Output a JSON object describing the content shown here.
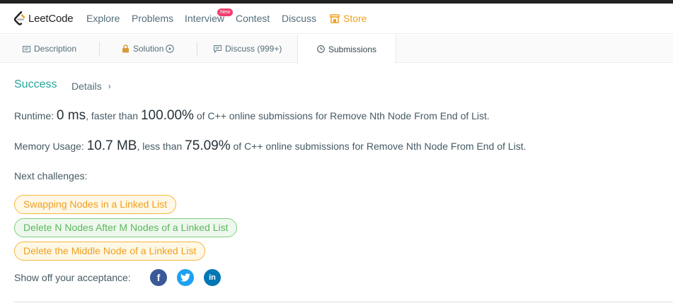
{
  "nav": {
    "logo_text": "LeetCode",
    "items": [
      "Explore",
      "Problems",
      "Interview",
      "Contest",
      "Discuss"
    ],
    "new_badge": "New",
    "store_label": "Store"
  },
  "tabs": {
    "description": "Description",
    "solution": "Solution",
    "discuss": "Discuss (999+)",
    "submissions": "Submissions"
  },
  "result": {
    "status": "Success",
    "details": "Details",
    "runtime_label": "Runtime: ",
    "runtime_value": "0 ms",
    "runtime_mid": ", faster than ",
    "runtime_pct": "100.00%",
    "runtime_suffix": " of C++ online submissions for Remove Nth Node From End of List.",
    "memory_label": "Memory Usage: ",
    "memory_value": "10.7 MB",
    "memory_mid": ", less than ",
    "memory_pct": "75.09%",
    "memory_suffix": " of C++ online submissions for Remove Nth Node From End of List."
  },
  "next": {
    "label": "Next challenges:",
    "challenges": [
      {
        "title": "Swapping Nodes in a Linked List",
        "difficulty": "medium"
      },
      {
        "title": "Delete N Nodes After M Nodes of a Linked List",
        "difficulty": "easy"
      },
      {
        "title": "Delete the Middle Node of a Linked List",
        "difficulty": "medium"
      }
    ]
  },
  "share": {
    "label": "Show off your acceptance:",
    "icons": [
      "facebook-icon",
      "twitter-icon",
      "linkedin-icon"
    ]
  },
  "colors": {
    "success": "#26a69a",
    "store": "#f0a020",
    "medium": "#f0a020",
    "easy": "#5cb85c",
    "new_badge": "#ef3f6f"
  }
}
